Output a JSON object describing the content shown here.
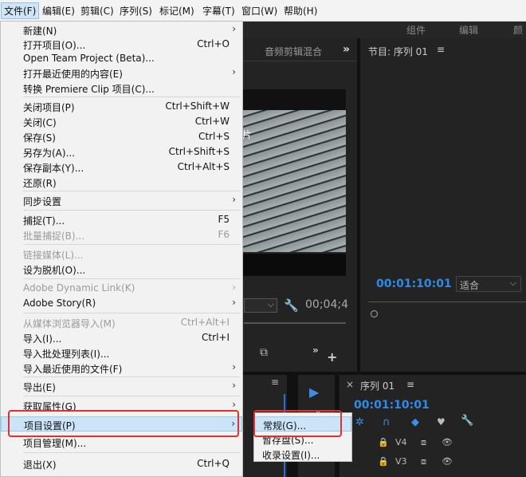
{
  "menubar": {
    "items": [
      "文件(F)",
      "编辑(E)",
      "剪辑(C)",
      "序列(S)",
      "标记(M)",
      "字幕(T)",
      "窗口(W)",
      "帮助(H)"
    ]
  },
  "workspaces": [
    "组件",
    "编辑",
    "颜"
  ],
  "source_panel": {
    "tab_label": "音频剪辑混合",
    "overflow": "»",
    "timecode": "00;04;4",
    "clip_text": "片"
  },
  "program_panel": {
    "title": "节目: 序列 01",
    "timecode": "00:01:10:01",
    "fit_label": "适合"
  },
  "timeline": {
    "close": "×",
    "title": "序列 01",
    "timecode": "00:01:10:01",
    "tracks": [
      "V4",
      "V3"
    ]
  },
  "file_menu": {
    "items": [
      {
        "label": "新建(N)",
        "shortcut": "",
        "arrow": true,
        "disabled": false
      },
      {
        "label": "打开项目(O)...",
        "shortcut": "Ctrl+O",
        "arrow": false,
        "disabled": false
      },
      {
        "label": "Open Team Project (Beta)...",
        "shortcut": "",
        "arrow": false,
        "disabled": false
      },
      {
        "label": "打开最近使用的内容(E)",
        "shortcut": "",
        "arrow": true,
        "disabled": false
      },
      {
        "label": "转换 Premiere Clip 项目(C)...",
        "shortcut": "",
        "arrow": false,
        "disabled": false
      },
      {
        "label": "关闭项目(P)",
        "shortcut": "Ctrl+Shift+W",
        "arrow": false,
        "disabled": false
      },
      {
        "label": "关闭(C)",
        "shortcut": "Ctrl+W",
        "arrow": false,
        "disabled": false
      },
      {
        "label": "保存(S)",
        "shortcut": "Ctrl+S",
        "arrow": false,
        "disabled": false
      },
      {
        "label": "另存为(A)...",
        "shortcut": "Ctrl+Shift+S",
        "arrow": false,
        "disabled": false
      },
      {
        "label": "保存副本(Y)...",
        "shortcut": "Ctrl+Alt+S",
        "arrow": false,
        "disabled": false
      },
      {
        "label": "还原(R)",
        "shortcut": "",
        "arrow": false,
        "disabled": false
      },
      {
        "label": "同步设置",
        "shortcut": "",
        "arrow": true,
        "disabled": false
      },
      {
        "label": "捕捉(T)...",
        "shortcut": "F5",
        "arrow": false,
        "disabled": false
      },
      {
        "label": "批量捕捉(B)...",
        "shortcut": "F6",
        "arrow": false,
        "disabled": true
      },
      {
        "label": "链接媒体(L)...",
        "shortcut": "",
        "arrow": false,
        "disabled": true
      },
      {
        "label": "设为脱机(O)...",
        "shortcut": "",
        "arrow": false,
        "disabled": false
      },
      {
        "label": "Adobe Dynamic Link(K)",
        "shortcut": "",
        "arrow": true,
        "disabled": true
      },
      {
        "label": "Adobe Story(R)",
        "shortcut": "",
        "arrow": true,
        "disabled": false
      },
      {
        "label": "从媒体浏览器导入(M)",
        "shortcut": "Ctrl+Alt+I",
        "arrow": false,
        "disabled": true
      },
      {
        "label": "导入(I)...",
        "shortcut": "Ctrl+I",
        "arrow": false,
        "disabled": false
      },
      {
        "label": "导入批处理列表(I)...",
        "shortcut": "",
        "arrow": false,
        "disabled": false
      },
      {
        "label": "导入最近使用的文件(F)",
        "shortcut": "",
        "arrow": true,
        "disabled": false
      },
      {
        "label": "导出(E)",
        "shortcut": "",
        "arrow": true,
        "disabled": false
      },
      {
        "label": "获取属性(G)",
        "shortcut": "",
        "arrow": true,
        "disabled": false
      },
      {
        "label": "项目设置(P)",
        "shortcut": "",
        "arrow": true,
        "disabled": false
      },
      {
        "label": "项目管理(M)...",
        "shortcut": "",
        "arrow": false,
        "disabled": false
      },
      {
        "label": "退出(X)",
        "shortcut": "Ctrl+Q",
        "arrow": false,
        "disabled": false
      }
    ]
  },
  "project_settings_submenu": {
    "items": [
      "常规(G)...",
      "暂存盘(S)...",
      "收录设置(I)..."
    ]
  },
  "colors": {
    "menu_bg": "#f2f2f2",
    "highlight": "#cce4f7",
    "annotation_red": "#e03030",
    "timecode_blue": "#2d8ceb",
    "panel_bg": "#232323"
  }
}
